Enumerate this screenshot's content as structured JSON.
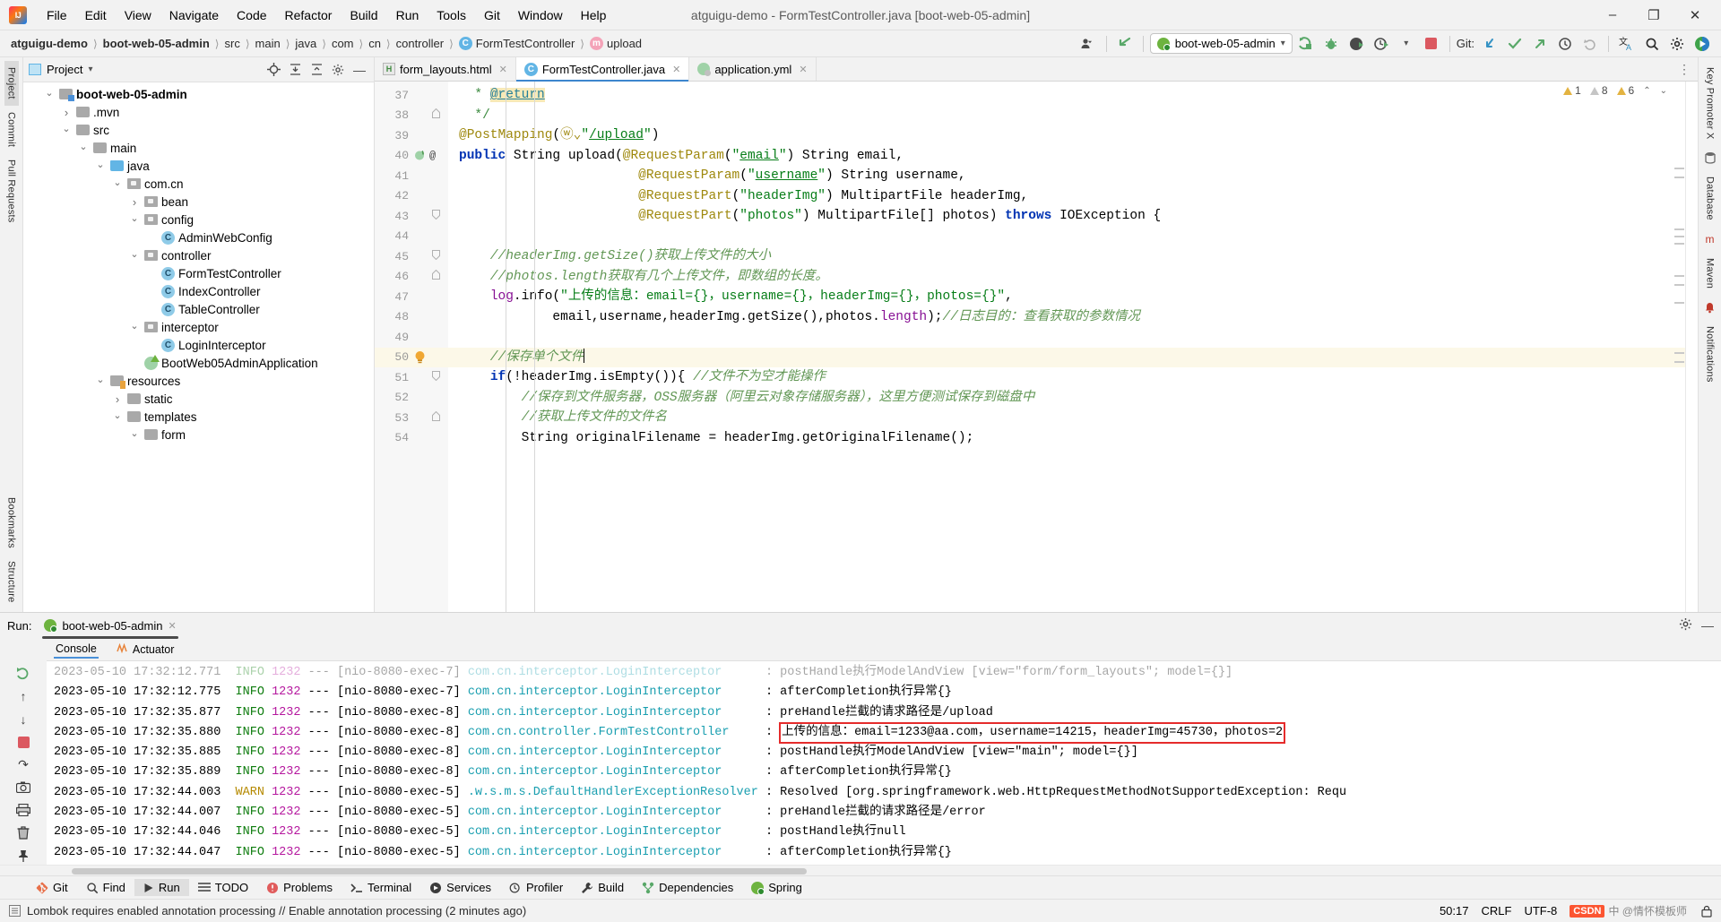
{
  "window": {
    "title": "atguigu-demo - FormTestController.java [boot-web-05-admin]",
    "minimize": "–",
    "maximize": "❐",
    "close": "✕"
  },
  "menu": {
    "items": [
      "File",
      "Edit",
      "View",
      "Navigate",
      "Code",
      "Refactor",
      "Build",
      "Run",
      "Tools",
      "Git",
      "Window",
      "Help"
    ]
  },
  "breadcrumbs": [
    {
      "label": "atguigu-demo",
      "bold": true,
      "icon": ""
    },
    {
      "label": "boot-web-05-admin",
      "bold": true,
      "icon": ""
    },
    {
      "label": "src",
      "bold": false,
      "icon": ""
    },
    {
      "label": "main",
      "bold": false,
      "icon": ""
    },
    {
      "label": "java",
      "bold": false,
      "icon": ""
    },
    {
      "label": "com",
      "bold": false,
      "icon": ""
    },
    {
      "label": "cn",
      "bold": false,
      "icon": ""
    },
    {
      "label": "controller",
      "bold": false,
      "icon": ""
    },
    {
      "label": "FormTestController",
      "bold": false,
      "icon": "class-badge"
    },
    {
      "label": "upload",
      "bold": false,
      "icon": "method-badge"
    }
  ],
  "toolbar": {
    "run_config": "boot-web-05-admin",
    "run_config_chevron": "▾",
    "profile_icon": "user-profile-icon",
    "back_arrow_icon": "back-arrow-icon",
    "run_icon": "run-icon",
    "debug_icon": "debug-icon",
    "run_with_coverage_icon": "coverage-icon",
    "profiler_icon": "profiler-icon",
    "stop_icon": "stop-icon",
    "git_label": "Git:",
    "git_update_icon": "update-project-icon",
    "git_commit_icon": "commit-icon",
    "git_push_icon": "push-icon",
    "history_icon": "history-icon",
    "rollback_icon": "rollback-icon",
    "translate_icon": "translate-icon",
    "search_icon": "search-everywhere-icon",
    "settings_icon": "settings-icon",
    "play_icon": "play-icon"
  },
  "rail_left": {
    "tabs": [
      "Project",
      "Commit",
      "Pull Requests"
    ],
    "bottom": [
      "Bookmarks",
      "Structure"
    ]
  },
  "rail_right": {
    "tabs": [
      "Key Promoter X",
      "Database",
      "Maven",
      "Notifications"
    ]
  },
  "project_panel": {
    "title": "Project",
    "title_chevron": "▾",
    "icons": [
      "locate-icon",
      "expand-all-icon",
      "collapse-all-icon",
      "settings-icon",
      "hide-icon"
    ],
    "tree": [
      {
        "depth": 1,
        "label": "boot-web-05-admin",
        "type": "module",
        "arrow": "down",
        "bold": true
      },
      {
        "depth": 2,
        "label": ".mvn",
        "type": "folder",
        "arrow": "right",
        "bold": false
      },
      {
        "depth": 2,
        "label": "src",
        "type": "folder",
        "arrow": "down",
        "bold": false
      },
      {
        "depth": 3,
        "label": "main",
        "type": "folder",
        "arrow": "down",
        "bold": false
      },
      {
        "depth": 4,
        "label": "java",
        "type": "folder-blue",
        "arrow": "down",
        "bold": false
      },
      {
        "depth": 5,
        "label": "com.cn",
        "type": "package",
        "arrow": "down",
        "bold": false
      },
      {
        "depth": 6,
        "label": "bean",
        "type": "package",
        "arrow": "right",
        "bold": false
      },
      {
        "depth": 6,
        "label": "config",
        "type": "package",
        "arrow": "down",
        "bold": false
      },
      {
        "depth": 7,
        "label": "AdminWebConfig",
        "type": "class",
        "arrow": "none",
        "bold": false
      },
      {
        "depth": 6,
        "label": "controller",
        "type": "package",
        "arrow": "down",
        "bold": false
      },
      {
        "depth": 7,
        "label": "FormTestController",
        "type": "class",
        "arrow": "none",
        "bold": false
      },
      {
        "depth": 7,
        "label": "IndexController",
        "type": "class",
        "arrow": "none",
        "bold": false
      },
      {
        "depth": 7,
        "label": "TableController",
        "type": "class",
        "arrow": "none",
        "bold": false
      },
      {
        "depth": 6,
        "label": "interceptor",
        "type": "package",
        "arrow": "down",
        "bold": false
      },
      {
        "depth": 7,
        "label": "LoginInterceptor",
        "type": "class",
        "arrow": "none",
        "bold": false
      },
      {
        "depth": 6,
        "label": "BootWeb05AdminApplication",
        "type": "spring-class",
        "arrow": "none",
        "bold": false
      },
      {
        "depth": 4,
        "label": "resources",
        "type": "folder-res",
        "arrow": "down",
        "bold": false
      },
      {
        "depth": 5,
        "label": "static",
        "type": "folder",
        "arrow": "right",
        "bold": false
      },
      {
        "depth": 5,
        "label": "templates",
        "type": "folder",
        "arrow": "down",
        "bold": false
      },
      {
        "depth": 6,
        "label": "form",
        "type": "folder",
        "arrow": "down",
        "bold": false
      }
    ]
  },
  "editor": {
    "tabs": [
      {
        "label": "form_layouts.html",
        "icon": "html-file-icon",
        "active": false,
        "close": "✕"
      },
      {
        "label": "FormTestController.java",
        "icon": "java-class-icon",
        "active": true,
        "close": "✕"
      },
      {
        "label": "application.yml",
        "icon": "yaml-spring-icon",
        "active": false,
        "close": "✕"
      }
    ],
    "more_icon": "⋮",
    "inspections": {
      "warnings": "1",
      "weak_warnings": "8",
      "typos": "6",
      "chevron_up": "⌃",
      "chevron_down": "⌄"
    },
    "lines": [
      {
        "num": "37",
        "indent": 0,
        "fold": "",
        "marks": "",
        "highlight": false,
        "segments": [
          {
            "t": "  * ",
            "c": "doc"
          },
          {
            "t": "@return",
            "c": "doctag"
          }
        ]
      },
      {
        "num": "38",
        "indent": 0,
        "fold": "fold-end",
        "marks": "",
        "highlight": false,
        "segments": [
          {
            "t": "  */",
            "c": "doc"
          }
        ]
      },
      {
        "num": "39",
        "indent": 0,
        "fold": "",
        "marks": "",
        "highlight": false,
        "segments": [
          {
            "t": "@PostMapping",
            "c": "ann"
          },
          {
            "t": "(",
            "c": "plain"
          },
          {
            "t": "ⓦ⌄",
            "c": "web"
          },
          {
            "t": "\"",
            "c": "str"
          },
          {
            "t": "/upload",
            "c": "str-link"
          },
          {
            "t": "\"",
            "c": "str"
          },
          {
            "t": ")",
            "c": "plain"
          }
        ]
      },
      {
        "num": "40",
        "indent": 0,
        "fold": "",
        "marks": "bean-icon @",
        "highlight": false,
        "segments": [
          {
            "t": "public ",
            "c": "kw"
          },
          {
            "t": "String ",
            "c": "plain"
          },
          {
            "t": "upload",
            "c": "plain"
          },
          {
            "t": "(",
            "c": "plain"
          },
          {
            "t": "@RequestParam",
            "c": "ann"
          },
          {
            "t": "(",
            "c": "plain"
          },
          {
            "t": "\"",
            "c": "str"
          },
          {
            "t": "email",
            "c": "str-link"
          },
          {
            "t": "\"",
            "c": "str"
          },
          {
            "t": ") String email,",
            "c": "plain"
          }
        ]
      },
      {
        "num": "41",
        "indent": 0,
        "fold": "",
        "marks": "",
        "highlight": false,
        "segments": [
          {
            "t": "                       ",
            "c": "plain"
          },
          {
            "t": "@RequestParam",
            "c": "ann"
          },
          {
            "t": "(",
            "c": "plain"
          },
          {
            "t": "\"",
            "c": "str"
          },
          {
            "t": "username",
            "c": "str-link"
          },
          {
            "t": "\"",
            "c": "str"
          },
          {
            "t": ") String username,",
            "c": "plain"
          }
        ]
      },
      {
        "num": "42",
        "indent": 0,
        "fold": "",
        "marks": "",
        "highlight": false,
        "segments": [
          {
            "t": "                       ",
            "c": "plain"
          },
          {
            "t": "@RequestPart",
            "c": "ann"
          },
          {
            "t": "(",
            "c": "plain"
          },
          {
            "t": "\"headerImg\"",
            "c": "str"
          },
          {
            "t": ") MultipartFile headerImg,",
            "c": "plain"
          }
        ]
      },
      {
        "num": "43",
        "indent": 0,
        "fold": "fold-start",
        "marks": "",
        "highlight": false,
        "segments": [
          {
            "t": "                       ",
            "c": "plain"
          },
          {
            "t": "@RequestPart",
            "c": "ann"
          },
          {
            "t": "(",
            "c": "plain"
          },
          {
            "t": "\"photos\"",
            "c": "str"
          },
          {
            "t": ") MultipartFile[] photos) ",
            "c": "plain"
          },
          {
            "t": "throws ",
            "c": "kw"
          },
          {
            "t": "IOException {",
            "c": "plain"
          }
        ]
      },
      {
        "num": "44",
        "indent": 0,
        "fold": "",
        "marks": "",
        "highlight": false,
        "segments": []
      },
      {
        "num": "45",
        "indent": 0,
        "fold": "fold-start",
        "marks": "",
        "highlight": false,
        "segments": [
          {
            "t": "    //headerImg.getSize()获取上传文件的大小",
            "c": "gcmt"
          }
        ]
      },
      {
        "num": "46",
        "indent": 0,
        "fold": "fold-end",
        "marks": "",
        "highlight": false,
        "segments": [
          {
            "t": "    //photos.length获取有几个上传文件，即数组的长度。",
            "c": "gcmt"
          }
        ]
      },
      {
        "num": "47",
        "indent": 0,
        "fold": "",
        "marks": "",
        "highlight": false,
        "segments": [
          {
            "t": "    ",
            "c": "plain"
          },
          {
            "t": "log",
            "c": "fld"
          },
          {
            "t": ".info(",
            "c": "plain"
          },
          {
            "t": "\"上传的信息：email={}，username={}，headerImg={}，photos={}\"",
            "c": "str"
          },
          {
            "t": ",",
            "c": "plain"
          }
        ]
      },
      {
        "num": "48",
        "indent": 0,
        "fold": "",
        "marks": "",
        "highlight": false,
        "segments": [
          {
            "t": "            email,username,headerImg.getSize(),photos.",
            "c": "plain"
          },
          {
            "t": "length",
            "c": "fld"
          },
          {
            "t": ");",
            "c": "plain"
          },
          {
            "t": "//日志目的：查看获取的参数情况",
            "c": "gcmt"
          }
        ]
      },
      {
        "num": "49",
        "indent": 0,
        "fold": "",
        "marks": "",
        "highlight": false,
        "segments": []
      },
      {
        "num": "50",
        "indent": 0,
        "fold": "",
        "marks": "bulb",
        "highlight": true,
        "segments": [
          {
            "t": "    //保存单个文件",
            "c": "gcmt"
          },
          {
            "t": "|",
            "c": "caret"
          }
        ]
      },
      {
        "num": "51",
        "indent": 0,
        "fold": "fold-start",
        "marks": "",
        "highlight": false,
        "segments": [
          {
            "t": "    ",
            "c": "plain"
          },
          {
            "t": "if",
            "c": "kw"
          },
          {
            "t": "(!headerImg.isEmpty()){ ",
            "c": "plain"
          },
          {
            "t": "//文件不为空才能操作",
            "c": "gcmt"
          }
        ]
      },
      {
        "num": "52",
        "indent": 0,
        "fold": "",
        "marks": "",
        "highlight": false,
        "segments": [
          {
            "t": "        //保存到文件服务器，OSS服务器（阿里云对象存储服务器），这里方便测试保存到磁盘中",
            "c": "gcmt"
          }
        ]
      },
      {
        "num": "53",
        "indent": 0,
        "fold": "fold-end",
        "marks": "",
        "highlight": false,
        "segments": [
          {
            "t": "        //获取上传文件的文件名",
            "c": "gcmt"
          }
        ]
      },
      {
        "num": "54",
        "indent": 0,
        "fold": "",
        "marks": "",
        "highlight": false,
        "segments": [
          {
            "t": "        String originalFilename = headerImg.getOriginalFilename();",
            "c": "plain"
          }
        ]
      }
    ]
  },
  "run_panel": {
    "label": "Run:",
    "tab": "boot-web-05-admin",
    "tab_close": "✕",
    "settings_icon": "settings-icon",
    "minimize_icon": "—",
    "subtabs": [
      {
        "label": "Console",
        "selected": true,
        "icon": ""
      },
      {
        "label": "Actuator",
        "selected": false,
        "icon": "actuator-icon"
      }
    ],
    "side_icons": [
      "rerun-icon",
      "scroll-up-icon",
      "scroll-down-icon",
      "stop-icon",
      "soft-wrap-icon",
      "camera-icon",
      "print-icon",
      "clear-all-icon",
      "pin-icon"
    ],
    "log_lines": [
      {
        "date": "2023-05-10 17:32:12.771",
        "level": "INFO",
        "pid": "1232",
        "thread": "[nio-8080-exec-7]",
        "logger": "com.cn.interceptor.LoginInterceptor",
        "msg": "postHandle执行ModelAndView [view=\"form/form_layouts\"; model={}]",
        "faded": true,
        "boxed": false
      },
      {
        "date": "2023-05-10 17:32:12.775",
        "level": "INFO",
        "pid": "1232",
        "thread": "[nio-8080-exec-7]",
        "logger": "com.cn.interceptor.LoginInterceptor",
        "msg": "afterCompletion执行异常{}",
        "faded": false,
        "boxed": false
      },
      {
        "date": "2023-05-10 17:32:35.877",
        "level": "INFO",
        "pid": "1232",
        "thread": "[nio-8080-exec-8]",
        "logger": "com.cn.interceptor.LoginInterceptor",
        "msg": "preHandle拦截的请求路径是/upload",
        "faded": false,
        "boxed": false
      },
      {
        "date": "2023-05-10 17:32:35.880",
        "level": "INFO",
        "pid": "1232",
        "thread": "[nio-8080-exec-8]",
        "logger": "com.cn.controller.FormTestController",
        "msg": "上传的信息：email=1233@aa.com，username=14215，headerImg=45730，photos=2",
        "faded": false,
        "boxed": true
      },
      {
        "date": "2023-05-10 17:32:35.885",
        "level": "INFO",
        "pid": "1232",
        "thread": "[nio-8080-exec-8]",
        "logger": "com.cn.interceptor.LoginInterceptor",
        "msg": "postHandle执行ModelAndView [view=\"main\"; model={}]",
        "faded": false,
        "boxed": false
      },
      {
        "date": "2023-05-10 17:32:35.889",
        "level": "INFO",
        "pid": "1232",
        "thread": "[nio-8080-exec-8]",
        "logger": "com.cn.interceptor.LoginInterceptor",
        "msg": "afterCompletion执行异常{}",
        "faded": false,
        "boxed": false
      },
      {
        "date": "2023-05-10 17:32:44.003",
        "level": "WARN",
        "pid": "1232",
        "thread": "[nio-8080-exec-5]",
        "logger": ".w.s.m.s.DefaultHandlerExceptionResolver",
        "msg": "Resolved [org.springframework.web.HttpRequestMethodNotSupportedException: Requ",
        "faded": false,
        "boxed": false
      },
      {
        "date": "2023-05-10 17:32:44.007",
        "level": "INFO",
        "pid": "1232",
        "thread": "[nio-8080-exec-5]",
        "logger": "com.cn.interceptor.LoginInterceptor",
        "msg": "preHandle拦截的请求路径是/error",
        "faded": false,
        "boxed": false
      },
      {
        "date": "2023-05-10 17:32:44.046",
        "level": "INFO",
        "pid": "1232",
        "thread": "[nio-8080-exec-5]",
        "logger": "com.cn.interceptor.LoginInterceptor",
        "msg": "postHandle执行null",
        "faded": false,
        "boxed": false
      },
      {
        "date": "2023-05-10 17:32:44.047",
        "level": "INFO",
        "pid": "1232",
        "thread": "[nio-8080-exec-5]",
        "logger": "com.cn.interceptor.LoginInterceptor",
        "msg": "afterCompletion执行异常{}",
        "faded": false,
        "boxed": false
      }
    ]
  },
  "bottom_toolbar": {
    "items": [
      {
        "label": "Git",
        "icon": "git-icon"
      },
      {
        "label": "Find",
        "icon": "find-icon"
      },
      {
        "label": "Run",
        "icon": "run-icon"
      },
      {
        "label": "TODO",
        "icon": "todo-icon"
      },
      {
        "label": "Problems",
        "icon": "problems-icon"
      },
      {
        "label": "Terminal",
        "icon": "terminal-icon"
      },
      {
        "label": "Services",
        "icon": "services-icon"
      },
      {
        "label": "Profiler",
        "icon": "profiler-icon"
      },
      {
        "label": "Build",
        "icon": "build-icon"
      },
      {
        "label": "Dependencies",
        "icon": "dependencies-icon"
      },
      {
        "label": "Spring",
        "icon": "spring-icon"
      }
    ]
  },
  "status_bar": {
    "message": "Lombok requires enabled annotation processing // Enable annotation processing (2 minutes ago)",
    "caret_position": "50:17",
    "line_separator": "CRLF",
    "encoding": "UTF-8",
    "indent": "",
    "lock_icon": "lock-icon",
    "watermark_logo": "CSDN",
    "watermark_text": "中 @情怀模板师"
  }
}
